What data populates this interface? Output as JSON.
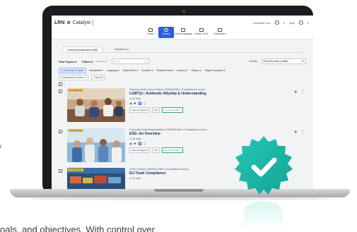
{
  "app": {
    "brand": "LRN",
    "product": "Catalyst",
    "user_name": "Jonathan Doe",
    "help_label": "Help"
  },
  "nav": [
    {
      "label": "Home",
      "icon": "home-icon",
      "active": false
    },
    {
      "label": "Library",
      "icon": "library-icon",
      "active": true
    },
    {
      "label": "Content Manager",
      "icon": "content-manager-icon",
      "active": false
    },
    {
      "label": "Admin Tools",
      "icon": "admin-tools-icon",
      "active": false
    },
    {
      "label": "Dashboard",
      "icon": "dashboard-icon",
      "active": false
    }
  ],
  "tabs": [
    {
      "label": "Learning Materials (468)",
      "active": true
    },
    {
      "label": "Playlists (1)",
      "active": false
    }
  ],
  "filters": {
    "find_topics": "Find Topics",
    "filters_label": "Filters",
    "clear_filters": "Clear Filters",
    "search_placeholder": "Search",
    "sort_by_label": "Sort By:",
    "sort_value": "Most Recently Created"
  },
  "filter_chips": [
    {
      "label": "Learning Format",
      "selected": true
    },
    {
      "label": "Bandwidth",
      "selected": false
    },
    {
      "label": "Language",
      "selected": false
    },
    {
      "label": "Audio/Video",
      "selected": false
    },
    {
      "label": "Duration",
      "selected": false
    },
    {
      "label": "Release Date",
      "selected": false
    },
    {
      "label": "Industry",
      "selected": false
    },
    {
      "label": "Region",
      "selected": false
    },
    {
      "label": "Target Employee",
      "selected": false
    }
  ],
  "active_filters": {
    "pill": "Foundational Course",
    "clear_all": "Clear All"
  },
  "courses": [
    {
      "meta": "Diversity, Equity, and Inclusion | DEI0001x9En | Foundational Course",
      "title": "LGBTQ+: Authentic Allyship & Understanding",
      "duration": "30 mins",
      "badge": "Coming Soon",
      "btn_insights": "View in Insights",
      "btn_count": "8",
      "btn_preview": "See Full Details"
    },
    {
      "meta": "Corporate Social Responsibility | CSR0001x9En | Foundational Course",
      "title": "ESG: An Overview",
      "duration": "30 mins",
      "badge": "Coming Soon",
      "btn_insights": "View in Insights",
      "btn_count": "8",
      "btn_preview": "See Full Details"
    },
    {
      "meta": "Trade Controls | DBA0017x9En | Foundational Course",
      "title": "EU Trade Compliance",
      "duration": "30 mins",
      "badge": "Coming Soon",
      "btn_insights": "",
      "btn_count": "",
      "btn_preview": ""
    }
  ],
  "background_text": {
    "left_fragment": "y",
    "bottom_fragment": "oals, and objectives. With control over"
  },
  "colors": {
    "accent_blue": "#2d5fd7",
    "badge_teal": "#1fb5a6",
    "badge_yellow": "#f5c33b"
  }
}
